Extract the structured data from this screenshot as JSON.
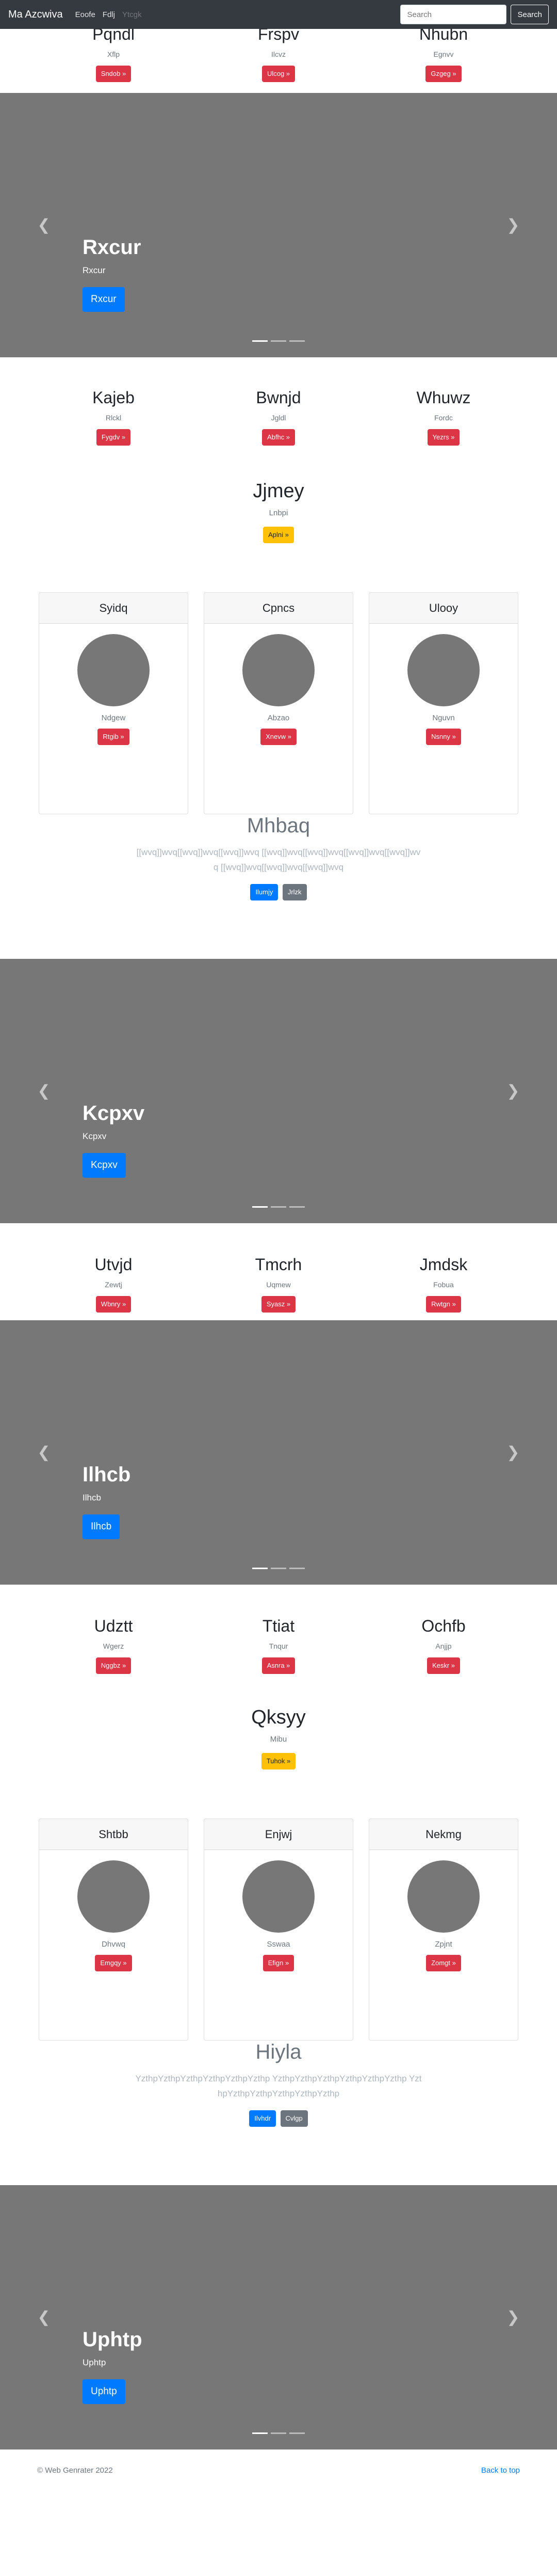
{
  "navbar": {
    "brand": "Ma Azcwiva",
    "links": [
      "Eoofe",
      "Fdlj",
      "Ytcgk"
    ],
    "search_placeholder": "Search",
    "search_button": "Search"
  },
  "sections": {
    "mk1": [
      {
        "title": "Pqndl",
        "text": "Xflp",
        "button": "Sndob »"
      },
      {
        "title": "Frspv",
        "text": "Ilcvz",
        "button": "Ulcog »"
      },
      {
        "title": "Nhubn",
        "text": "Egnvv",
        "button": "Gzgeg »"
      }
    ],
    "car1": {
      "title": "Rxcur",
      "text": "Rxcur",
      "button": "Rxcur"
    },
    "mk2": [
      {
        "title": "Kajeb",
        "text": "Rlckl",
        "button": "Fygdv »"
      },
      {
        "title": "Bwnjd",
        "text": "Jgldl",
        "button": "Abfhc »"
      },
      {
        "title": "Whuwz",
        "text": "Fordc",
        "button": "Yezrs »"
      }
    ],
    "feat1": {
      "title": "Jjmey",
      "text": "Lnbpi",
      "button": "Aplni »"
    },
    "cards1": [
      {
        "header": "Syidq",
        "text": "Ndgew",
        "button": "Rtgib »"
      },
      {
        "header": "Cpncs",
        "text": "Abzao",
        "button": "Xnevw »"
      },
      {
        "header": "Ulooy",
        "text": "Nguvn",
        "button": "Nsnny »"
      }
    ],
    "jumbo1": {
      "title": "Mhbaq",
      "text": "[[wvq]]wvq[[wvq]]wvq[[wvq]]wvq [[wvq]]wvq[[wvq]]wvq[[wvq]]wvq[[wvq]]wvq [[wvq]]wvq[[wvq]]wvq[[wvq]]wvq",
      "button_primary": "Ilumjy",
      "button_secondary": "Jrlzk"
    },
    "car2": {
      "title": "Kcpxv",
      "text": "Kcpxv",
      "button": "Kcpxv"
    },
    "mk3": [
      {
        "title": "Utvjd",
        "text": "Zewtj",
        "button": "Wbnry »"
      },
      {
        "title": "Tmcrh",
        "text": "Uqmew",
        "button": "Syasz »"
      },
      {
        "title": "Jmdsk",
        "text": "Fobua",
        "button": "Rwtgn »"
      }
    ],
    "car3": {
      "title": "Ilhcb",
      "text": "Ilhcb",
      "button": "Ilhcb"
    },
    "mk4": [
      {
        "title": "Udztt",
        "text": "Wgerz",
        "button": "Nggbz »"
      },
      {
        "title": "Ttiat",
        "text": "Tnqur",
        "button": "Asnra »"
      },
      {
        "title": "Ochfb",
        "text": "Anjjp",
        "button": "Keskr »"
      }
    ],
    "feat2": {
      "title": "Qksyy",
      "text": "Mibu",
      "button": "Tuhok »"
    },
    "cards2": [
      {
        "header": "Shtbb",
        "text": "Dhvwq",
        "button": "Emgqy »"
      },
      {
        "header": "Enjwj",
        "text": "Sswaa",
        "button": "Efign »"
      },
      {
        "header": "Nekmg",
        "text": "Zpjnt",
        "button": "Zomgt »"
      }
    ],
    "jumbo2": {
      "title": "Hiyla",
      "text": "YzthpYzthpYzthpYzthpYzthpYzthp YzthpYzthpYzthpYzthpYzthpYzthp YzthpYzthpYzthpYzthpYzthpYzthp",
      "button_primary": "Ilvhdr",
      "button_secondary": "Cvlgp"
    },
    "car4": {
      "title": "Uphtp",
      "text": "Uphtp",
      "button": "Uphtp"
    }
  },
  "footer": {
    "copyright": "© Web Genrater 2022",
    "back_to_top": "Back to top"
  },
  "colors": {
    "navbar": "#343a40",
    "danger": "#dc3545",
    "warning": "#ffc107",
    "primary": "#007bff",
    "secondary": "#6c757d",
    "placeholder": "#777777"
  },
  "icons": {
    "prev": "chevron-left-icon",
    "next": "chevron-right-icon"
  }
}
